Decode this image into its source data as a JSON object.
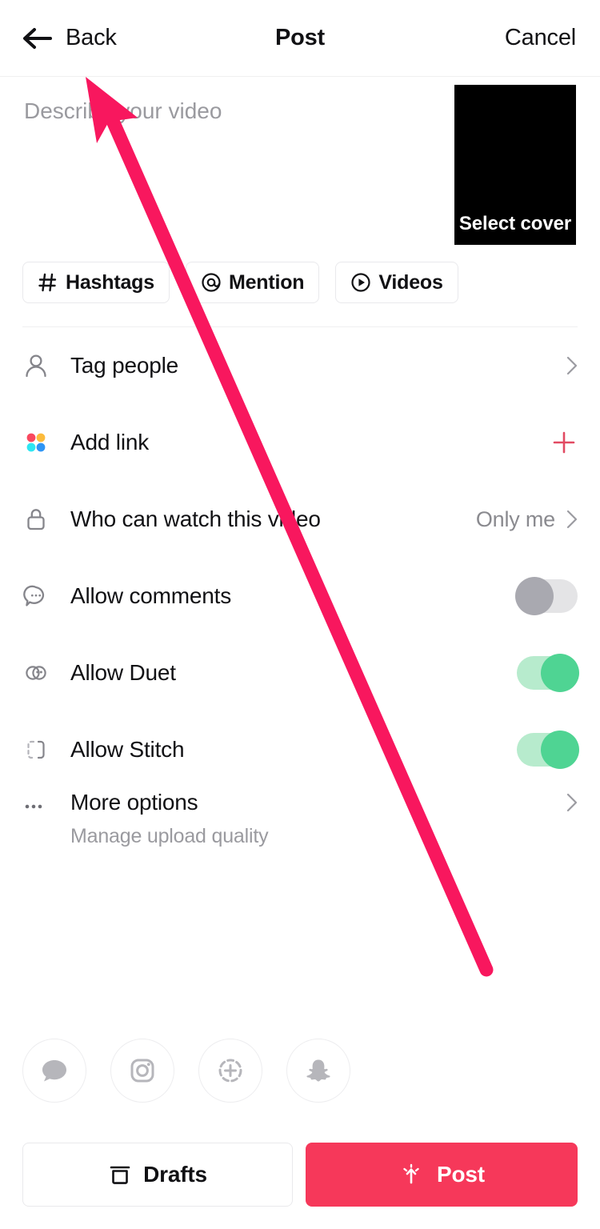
{
  "header": {
    "back_label": "Back",
    "title": "Post",
    "cancel_label": "Cancel",
    "back_icon": "arrow-left-icon"
  },
  "caption": {
    "value": "",
    "placeholder": "Describe your video"
  },
  "cover": {
    "label": "Select cover",
    "background": "#000000"
  },
  "chips": [
    {
      "icon": "hashtag-icon",
      "label": "Hashtags"
    },
    {
      "icon": "at-mention-icon",
      "label": "Mention"
    },
    {
      "icon": "play-circle-icon",
      "label": "Videos"
    }
  ],
  "settings": [
    {
      "icon": "person-icon",
      "label": "Tag people",
      "control": "chevron",
      "value": ""
    },
    {
      "icon": "four-dots-icon",
      "label": "Add link",
      "control": "plus",
      "value": ""
    },
    {
      "icon": "lock-icon",
      "label": "Who can watch this video",
      "control": "value-chevron",
      "value": "Only me"
    },
    {
      "icon": "comment-icon",
      "label": "Allow comments",
      "control": "toggle",
      "toggle_state": "off"
    },
    {
      "icon": "duet-icon",
      "label": "Allow Duet",
      "control": "toggle",
      "toggle_state": "on"
    },
    {
      "icon": "stitch-icon",
      "label": "Allow Stitch",
      "control": "toggle",
      "toggle_state": "on"
    }
  ],
  "more_options": {
    "icon": "ellipsis-icon",
    "title": "More options",
    "description": "Manage upload quality",
    "control": "chevron"
  },
  "share_targets": [
    {
      "icon": "message-bubble-icon",
      "name": "messages"
    },
    {
      "icon": "instagram-icon",
      "name": "instagram"
    },
    {
      "icon": "instagram-story-icon",
      "name": "instagram-story"
    },
    {
      "icon": "snapchat-icon",
      "name": "snapchat"
    }
  ],
  "bottom_bar": {
    "drafts_label": "Drafts",
    "drafts_icon": "archive-icon",
    "post_label": "Post",
    "post_icon": "upload-burst-icon"
  },
  "colors": {
    "accent_red": "#f6385a",
    "annotation_arrow": "#f8175e",
    "toggle_on_track": "#b7ebcd",
    "toggle_on_knob": "#4fd493",
    "toggle_off_track": "#e4e4e6",
    "toggle_off_knob": "#a9a9b0",
    "add_link_plus": "#e24a62",
    "muted_text": "#8a8a8f",
    "primary_text": "#111114"
  }
}
